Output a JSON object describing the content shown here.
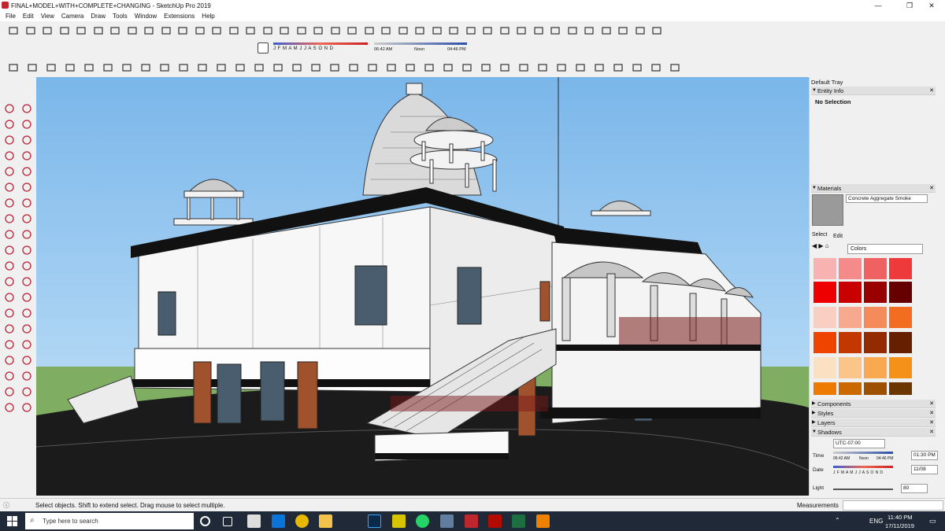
{
  "window": {
    "title": "FINAL+MODEL+WITH+COMPLETE+CHANGING - SketchUp Pro 2019",
    "minimize": "—",
    "maximize": "❐",
    "close": "✕"
  },
  "menu": [
    "File",
    "Edit",
    "View",
    "Camera",
    "Draw",
    "Tools",
    "Window",
    "Extensions",
    "Help"
  ],
  "shadow_toolbar": {
    "months": "J F M A M J J A S O N D",
    "time_start": "06:42 AM",
    "time_mid": "Noon",
    "time_end": "04:46 PM"
  },
  "tray": {
    "title": "Default Tray",
    "entity_info": {
      "label": "Entity Info",
      "value": "No Selection"
    },
    "materials": {
      "label": "Materials",
      "name": "Concrete Aggregate Smoke",
      "tab_select": "Select",
      "tab_edit": "Edit",
      "collection": "Colors"
    },
    "collapsed": [
      "Components",
      "Styles",
      "Layers"
    ],
    "shadows": {
      "label": "Shadows",
      "timezone": "UTC-07:00",
      "time_label": "Time",
      "time_start": "06:42 AM",
      "time_mid": "Noon",
      "time_end": "04:46 PM",
      "time_value": "01:30 PM",
      "date_label": "Date",
      "months": "J F M A M J J A S O N D",
      "date_value": "11/08",
      "light_label": "Light",
      "light_value": "80"
    }
  },
  "swatches": [
    "#f7b2b2",
    "#f48a8a",
    "#f06262",
    "#ee3a3a",
    "#ee0000",
    "#c80000",
    "#990000",
    "#660000",
    "#f9cfc4",
    "#f7a98f",
    "#f58a5a",
    "#f26d20",
    "#ee4400",
    "#c33800",
    "#942a00",
    "#662000",
    "#fbe0c2",
    "#fbc488",
    "#f9a94f",
    "#f59018",
    "#ef7a00",
    "#cc6800",
    "#9c5000",
    "#6b3600"
  ],
  "status": {
    "message": "Select objects. Shift to extend select. Drag mouse to select multiple.",
    "measurements_label": "Measurements"
  },
  "taskbar": {
    "search_placeholder": "Type here to search",
    "lang": "ENG",
    "time": "11:40 PM",
    "date": "17/11/2019"
  }
}
